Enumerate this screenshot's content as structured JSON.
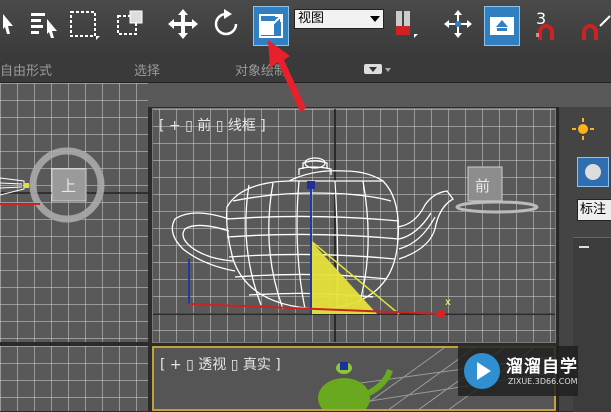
{
  "toolbar": {
    "view_dropdown": {
      "value": "视图"
    },
    "number_label": "3"
  },
  "ribbon": {
    "items": [
      "自由形式",
      "选择",
      "对象绘制"
    ]
  },
  "viewports": {
    "front_label": "[ + ▯ 前 ▯ 线框 ]",
    "perspective_label": "[ + ▯ 透视 ▯ 真实 ]",
    "viewcube_top_label": "上",
    "viewcube_front_label": "前",
    "axis_x": "x"
  },
  "command_panel": {
    "label": "标注"
  },
  "watermark": {
    "title": "溜溜自学",
    "subtitle": "ZIXUE.3D66.COM"
  },
  "colors": {
    "active_button": "#2f7fc1",
    "annotation_arrow": "#e8202b",
    "selection_fill": "#e6e23a",
    "viewport_bg": "#595959",
    "perspective_border": "#c0a23c"
  }
}
